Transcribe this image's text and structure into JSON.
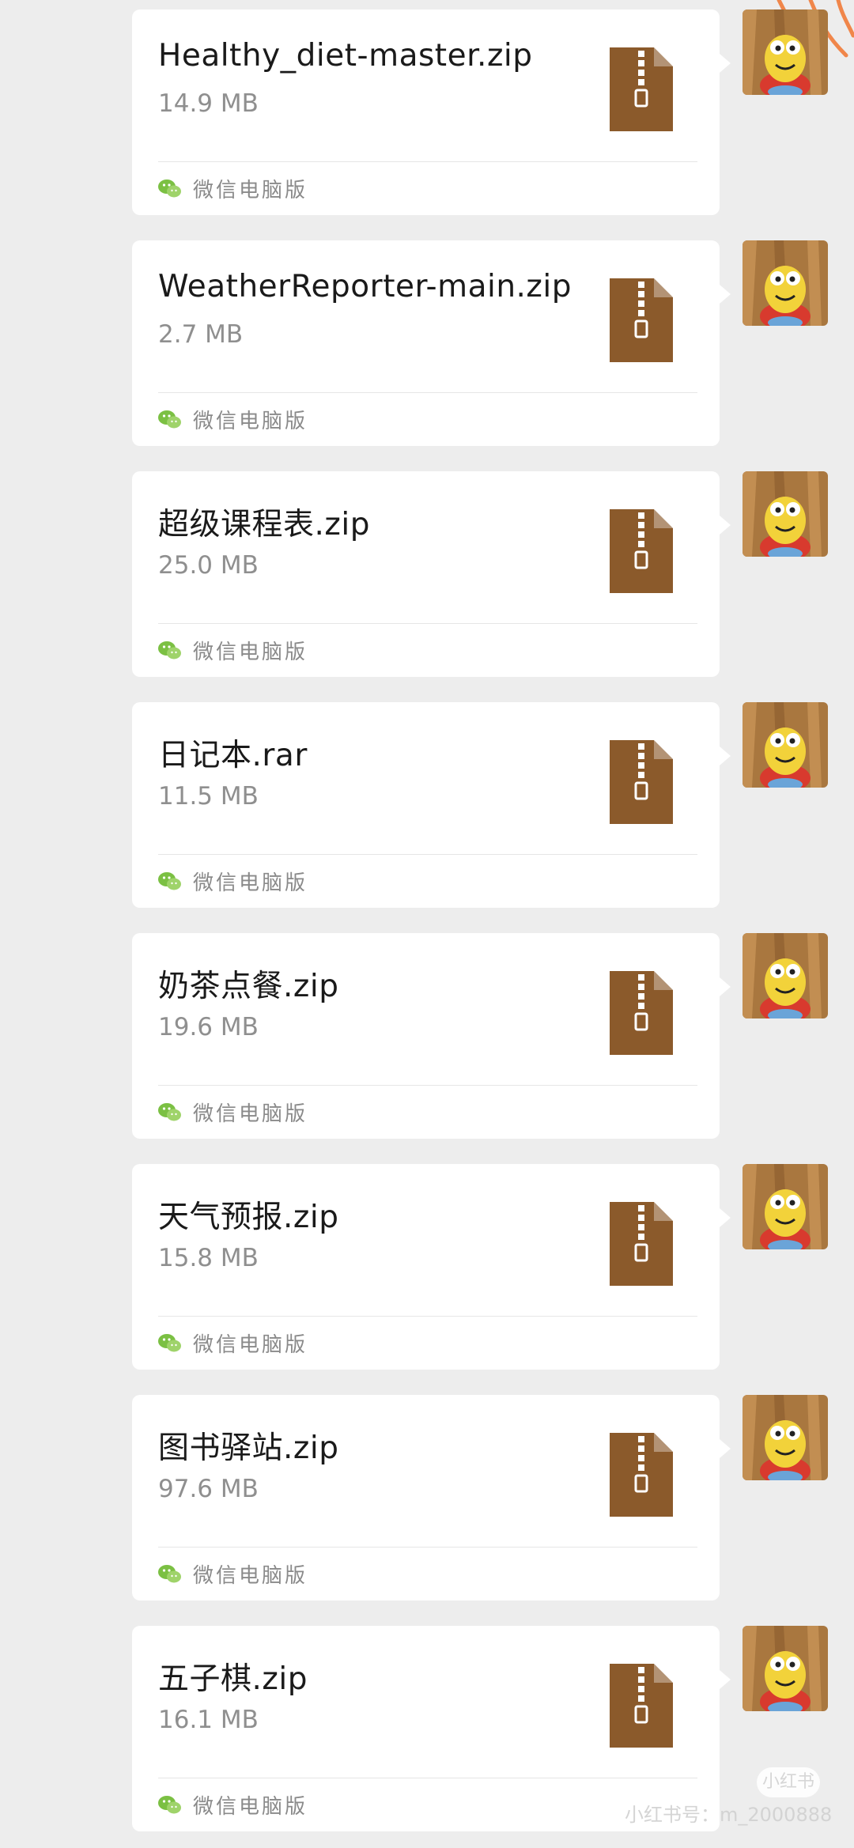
{
  "colors": {
    "background": "#ededed",
    "card": "#ffffff",
    "zip_icon": "#8b5a2b",
    "source_icon": "#7bc043",
    "scribble": "#f0864a"
  },
  "messages": [
    {
      "file_name": "Healthy_diet-master.zip",
      "file_size": "14.9 MB",
      "source": "微信电脑版"
    },
    {
      "file_name": "WeatherReporter-main.zip",
      "file_size": "2.7 MB",
      "source": "微信电脑版"
    },
    {
      "file_name": "超级课程表.zip",
      "file_size": "25.0 MB",
      "source": "微信电脑版"
    },
    {
      "file_name": "日记本.rar",
      "file_size": "11.5 MB",
      "source": "微信电脑版"
    },
    {
      "file_name": "奶茶点餐.zip",
      "file_size": "19.6 MB",
      "source": "微信电脑版"
    },
    {
      "file_name": "天气预报.zip",
      "file_size": "15.8 MB",
      "source": "微信电脑版"
    },
    {
      "file_name": "图书驿站.zip",
      "file_size": "97.6 MB",
      "source": "微信电脑版"
    },
    {
      "file_name": "五子棋.zip",
      "file_size": "16.1 MB",
      "source": "微信电脑版"
    }
  ],
  "icons": {
    "file": "zip-file-icon",
    "source": "wechat-icon",
    "avatar": "avatar-cartoon"
  },
  "watermark": {
    "logo": "小红书",
    "id": "小红书号：m_2000888"
  }
}
